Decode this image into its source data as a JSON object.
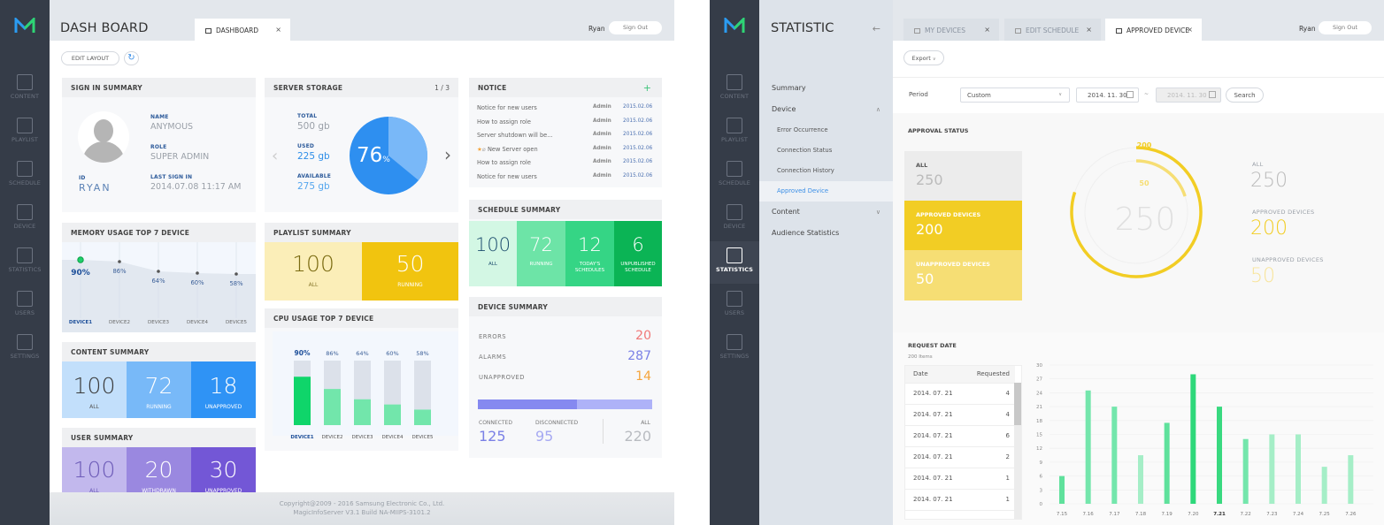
{
  "rail": {
    "items": [
      {
        "icon": "content-icon",
        "label": "CONTENT"
      },
      {
        "icon": "playlist-icon",
        "label": "PLAYLIST"
      },
      {
        "icon": "schedule-icon",
        "label": "SCHEDULE"
      },
      {
        "icon": "device-icon",
        "label": "DEVICE"
      },
      {
        "icon": "statistics-icon",
        "label": "STATISTICS"
      },
      {
        "icon": "users-icon",
        "label": "USERS"
      },
      {
        "icon": "settings-icon",
        "label": "SETTINGS"
      }
    ]
  },
  "dashboard": {
    "title": "DASH BOARD",
    "tab": {
      "label": "DASHBOARD",
      "close": "×"
    },
    "user": "Ryan",
    "sign_out": "Sign Out",
    "edit_layout": "EDIT LAYOUT",
    "refresh_icon": "↻",
    "sign_in": {
      "title": "SIGN IN SUMMARY",
      "id_label": "ID",
      "id_value": "RYAN",
      "name_label": "NAME",
      "name_value": "ANYMOUS",
      "role_label": "ROLE",
      "role_value": "SUPER ADMIN",
      "last_label": "LAST SIGN IN",
      "last_value": "2014.07.08 11:17 AM"
    },
    "storage": {
      "title": "SERVER STORAGE",
      "pager": "1 / 3",
      "total_label": "TOTAL",
      "total_value": "500 gb",
      "used_label": "USED",
      "used_value": "225 gb",
      "available_label": "AVAILABLE",
      "available_value": "275 gb",
      "percent": "76",
      "percent_unit": "%",
      "percent_fraction": 0.64
    },
    "notice": {
      "title": "NOTICE",
      "add": "+",
      "rows": [
        {
          "title": "Notice for new users",
          "author": "Admin",
          "date": "2015.02.06",
          "flag": false
        },
        {
          "title": "How to assign role",
          "author": "Admin",
          "date": "2015.02.06",
          "flag": false
        },
        {
          "title": "Server shutdown will be...",
          "author": "Admin",
          "date": "2015.02.06",
          "flag": false
        },
        {
          "title": "New Server open",
          "author": "Admin",
          "date": "2015.02.06",
          "flag": true
        },
        {
          "title": "How to assign role",
          "author": "Admin",
          "date": "2015.02.06",
          "flag": false
        },
        {
          "title": "Notice for new users",
          "author": "Admin",
          "date": "2015.02.06",
          "flag": false
        }
      ]
    },
    "memory": {
      "title": "MEMORY USAGE TOP 7 DEVICE",
      "devices": [
        "DEVICE1",
        "DEVICE2",
        "DEVICE3",
        "DEVICE4",
        "DEVICE5"
      ],
      "values": [
        90,
        86,
        64,
        60,
        58
      ],
      "labels": [
        "90%",
        "86%",
        "64%",
        "60%",
        "58%"
      ]
    },
    "playlist": {
      "title": "PLAYLIST SUMMARY",
      "tiles": [
        {
          "value": "100",
          "label": "ALL"
        },
        {
          "value": "50",
          "label": "RUNNING"
        }
      ]
    },
    "schedule": {
      "title": "SCHEDULE SUMMARY",
      "tiles": [
        {
          "value": "100",
          "label": "ALL"
        },
        {
          "value": "72",
          "label": "RUNNING"
        },
        {
          "value": "12",
          "label": "TODAY'S SCHEDULES"
        },
        {
          "value": "6",
          "label": "UNPUBLISHED SCHEDULE"
        }
      ]
    },
    "content": {
      "title": "CONTENT SUMMARY",
      "tiles": [
        {
          "value": "100",
          "label": "ALL"
        },
        {
          "value": "72",
          "label": "RUNNING"
        },
        {
          "value": "18",
          "label": "UNAPPROVED"
        }
      ]
    },
    "cpu": {
      "title": "CPU USAGE TOP 7 DEVICE",
      "devices": [
        "DEVICE1",
        "DEVICE2",
        "DEVICE3",
        "DEVICE4",
        "DEVICE5"
      ],
      "values": [
        90,
        86,
        64,
        60,
        58
      ],
      "labels": [
        "90%",
        "86%",
        "64%",
        "60%",
        "58%"
      ],
      "fill_fraction": [
        0.75,
        0.56,
        0.4,
        0.32,
        0.24
      ]
    },
    "device_summary": {
      "title": "DEVICE SUMMARY",
      "errors_label": "ERRORS",
      "errors": "20",
      "alarms_label": "ALARMS",
      "alarms": "287",
      "unapproved_label": "UNAPPROVED",
      "unapproved": "14",
      "connected_label": "CONNECTED",
      "connected": "125",
      "disconnected_label": "DISCONNECTED",
      "disconnected": "95",
      "all_label": "ALL",
      "all": "220",
      "connected_fraction": 0.57
    },
    "users": {
      "title": "USER SUMMARY",
      "tiles": [
        {
          "value": "100",
          "label": "ALL"
        },
        {
          "value": "20",
          "label": "WITHDRAWN"
        },
        {
          "value": "30",
          "label": "UNAPPROVED"
        }
      ]
    },
    "footer": {
      "line1": "Copyright@2009 - 2016 Samsung Electronic Co., Ltd.",
      "line2": "MagicInfoServer V3.1 Build NA-MIIPS-3101.2"
    }
  },
  "statistic": {
    "title": "STATISTIC",
    "back_icon": "←",
    "nav": [
      {
        "label": "Summary",
        "type": "top"
      },
      {
        "label": "Device",
        "type": "top",
        "expanded": true
      },
      {
        "label": "Error Occurrence",
        "type": "sub"
      },
      {
        "label": "Connection Status",
        "type": "sub"
      },
      {
        "label": "Connection History",
        "type": "sub"
      },
      {
        "label": "Approved Device",
        "type": "sub",
        "selected": true
      },
      {
        "label": "Content",
        "type": "top",
        "expanded": false
      },
      {
        "label": "Audience Statistics",
        "type": "top"
      }
    ],
    "tabs": [
      {
        "label": "MY DEVICES",
        "close": "×"
      },
      {
        "label": "EDIT SCHEDULE",
        "close": "×"
      },
      {
        "label": "APPROVED DEVICE",
        "close": "×"
      }
    ],
    "user": "Ryan",
    "sign_out": "Sign Out",
    "export": "Export",
    "period_label": "Period",
    "period_value": "Custom",
    "date_from": "2014. 11. 30",
    "date_sep": "~",
    "date_to": "2014. 11. 30",
    "search": "Search",
    "approval": {
      "title": "APPROVAL STATUS",
      "all_label": "ALL",
      "all": "250",
      "approved_label": "APPROVED DEVICES",
      "approved": "200",
      "unapproved_label": "UNAPPROVED DEVICES",
      "unapproved": "50",
      "center": "250",
      "ring_outer_label": "200",
      "ring_inner_label": "50",
      "colors": {
        "approved": "#f2cd24",
        "unapproved": "#f6de74",
        "all": "#ececec"
      }
    },
    "request": {
      "title": "REQUEST DATE",
      "count": "200 Items",
      "columns": [
        "Date",
        "Requested"
      ],
      "rows": [
        {
          "date": "2014. 07. 21",
          "requested": "4"
        },
        {
          "date": "2014. 07. 21",
          "requested": "4"
        },
        {
          "date": "2014. 07. 21",
          "requested": "6"
        },
        {
          "date": "2014. 07. 21",
          "requested": "2"
        },
        {
          "date": "2014. 07. 21",
          "requested": "1"
        },
        {
          "date": "2014. 07. 21",
          "requested": "1"
        }
      ]
    }
  },
  "chart_data": [
    {
      "type": "line",
      "title": "MEMORY USAGE TOP 7 DEVICE",
      "categories": [
        "DEVICE1",
        "DEVICE2",
        "DEVICE3",
        "DEVICE4",
        "DEVICE5"
      ],
      "values": [
        90,
        86,
        64,
        60,
        58
      ],
      "unit": "%"
    },
    {
      "type": "bar",
      "title": "CPU USAGE TOP 7 DEVICE",
      "categories": [
        "DEVICE1",
        "DEVICE2",
        "DEVICE3",
        "DEVICE4",
        "DEVICE5"
      ],
      "values": [
        90,
        86,
        64,
        60,
        58
      ],
      "unit": "%"
    },
    {
      "type": "pie",
      "title": "SERVER STORAGE",
      "labels": [
        "Used",
        "Available"
      ],
      "values": [
        64,
        36
      ],
      "center_label": "76%"
    },
    {
      "type": "bar",
      "title": "REQUEST DATE",
      "categories": [
        "7.15",
        "7.16",
        "7.17",
        "7.18",
        "7.19",
        "7.20",
        "7.21",
        "7.22",
        "7.23",
        "7.24",
        "7.25",
        "7.26"
      ],
      "values": [
        6,
        24.5,
        21,
        10.5,
        17.5,
        28,
        21,
        14,
        15,
        15,
        8,
        10.5
      ],
      "ylim": [
        0,
        30
      ],
      "yticks": [
        0,
        3,
        6,
        9,
        12,
        15,
        18,
        21,
        24,
        27,
        30
      ],
      "highlight": "7.21",
      "grid": true
    }
  ]
}
